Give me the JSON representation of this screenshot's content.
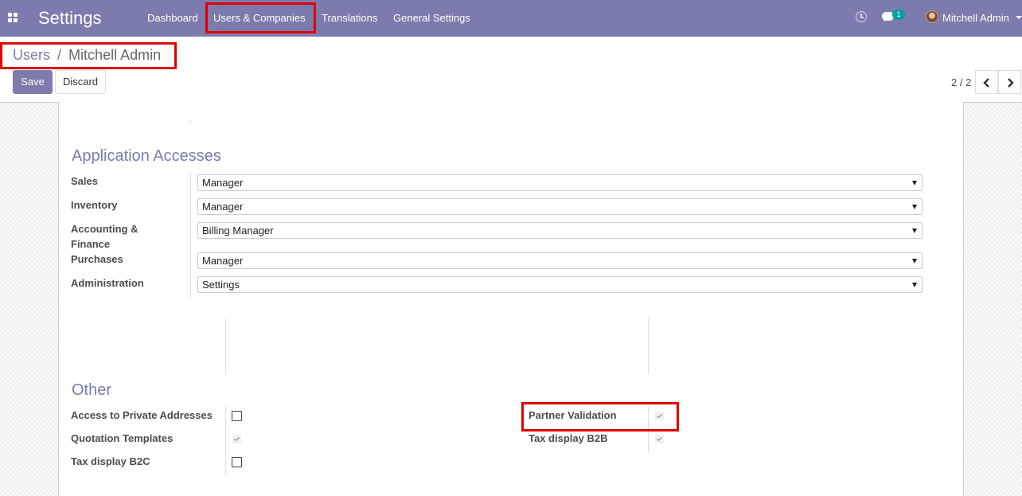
{
  "navbar": {
    "app_title": "Settings",
    "menu": [
      "Dashboard",
      "Users & Companies",
      "Translations",
      "General Settings"
    ],
    "chat_badge": "1",
    "user_name": "Mitchell Admin"
  },
  "breadcrumb": {
    "parent": "Users",
    "separator": "/",
    "current": "Mitchell Admin"
  },
  "actions": {
    "save": "Save",
    "discard": "Discard"
  },
  "pager": {
    "value": "2 / 2"
  },
  "application_accesses": {
    "title": "Application Accesses",
    "fields": [
      {
        "label": "Sales",
        "value": "Manager"
      },
      {
        "label": "Inventory",
        "value": "Manager"
      },
      {
        "label": "Accounting & Finance",
        "value": "Billing Manager"
      },
      {
        "label": "Purchases",
        "value": "Manager"
      },
      {
        "label": "Administration",
        "value": "Settings"
      }
    ]
  },
  "other": {
    "title": "Other",
    "left": [
      {
        "label": "Access to Private Addresses",
        "checked": false
      },
      {
        "label": "Quotation Templates",
        "checked": true
      },
      {
        "label": "Tax display B2C",
        "checked": false
      }
    ],
    "right": [
      {
        "label": "Partner Validation",
        "checked": true
      },
      {
        "label": "Tax display B2B",
        "checked": true
      }
    ]
  },
  "colors": {
    "brand": "#7c7bad",
    "highlight": "#e00000",
    "badge": "#00a09d"
  }
}
